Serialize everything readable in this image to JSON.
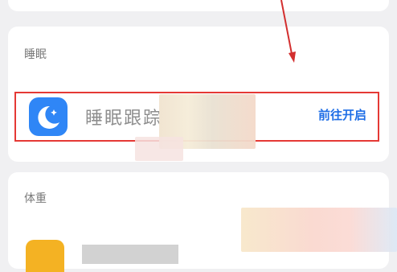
{
  "sleep_section": {
    "title": "睡眠",
    "row_label": "睡眠跟踪",
    "action_label": "前往开启"
  },
  "weight_section": {
    "title": "体重"
  },
  "colors": {
    "highlight_border": "#e53935",
    "app_icon_bg": "#2f86f6",
    "link": "#1f6ee6"
  },
  "icons": {
    "sleep_app": "moon-star-icon",
    "weight_app": "weight-app-icon"
  }
}
